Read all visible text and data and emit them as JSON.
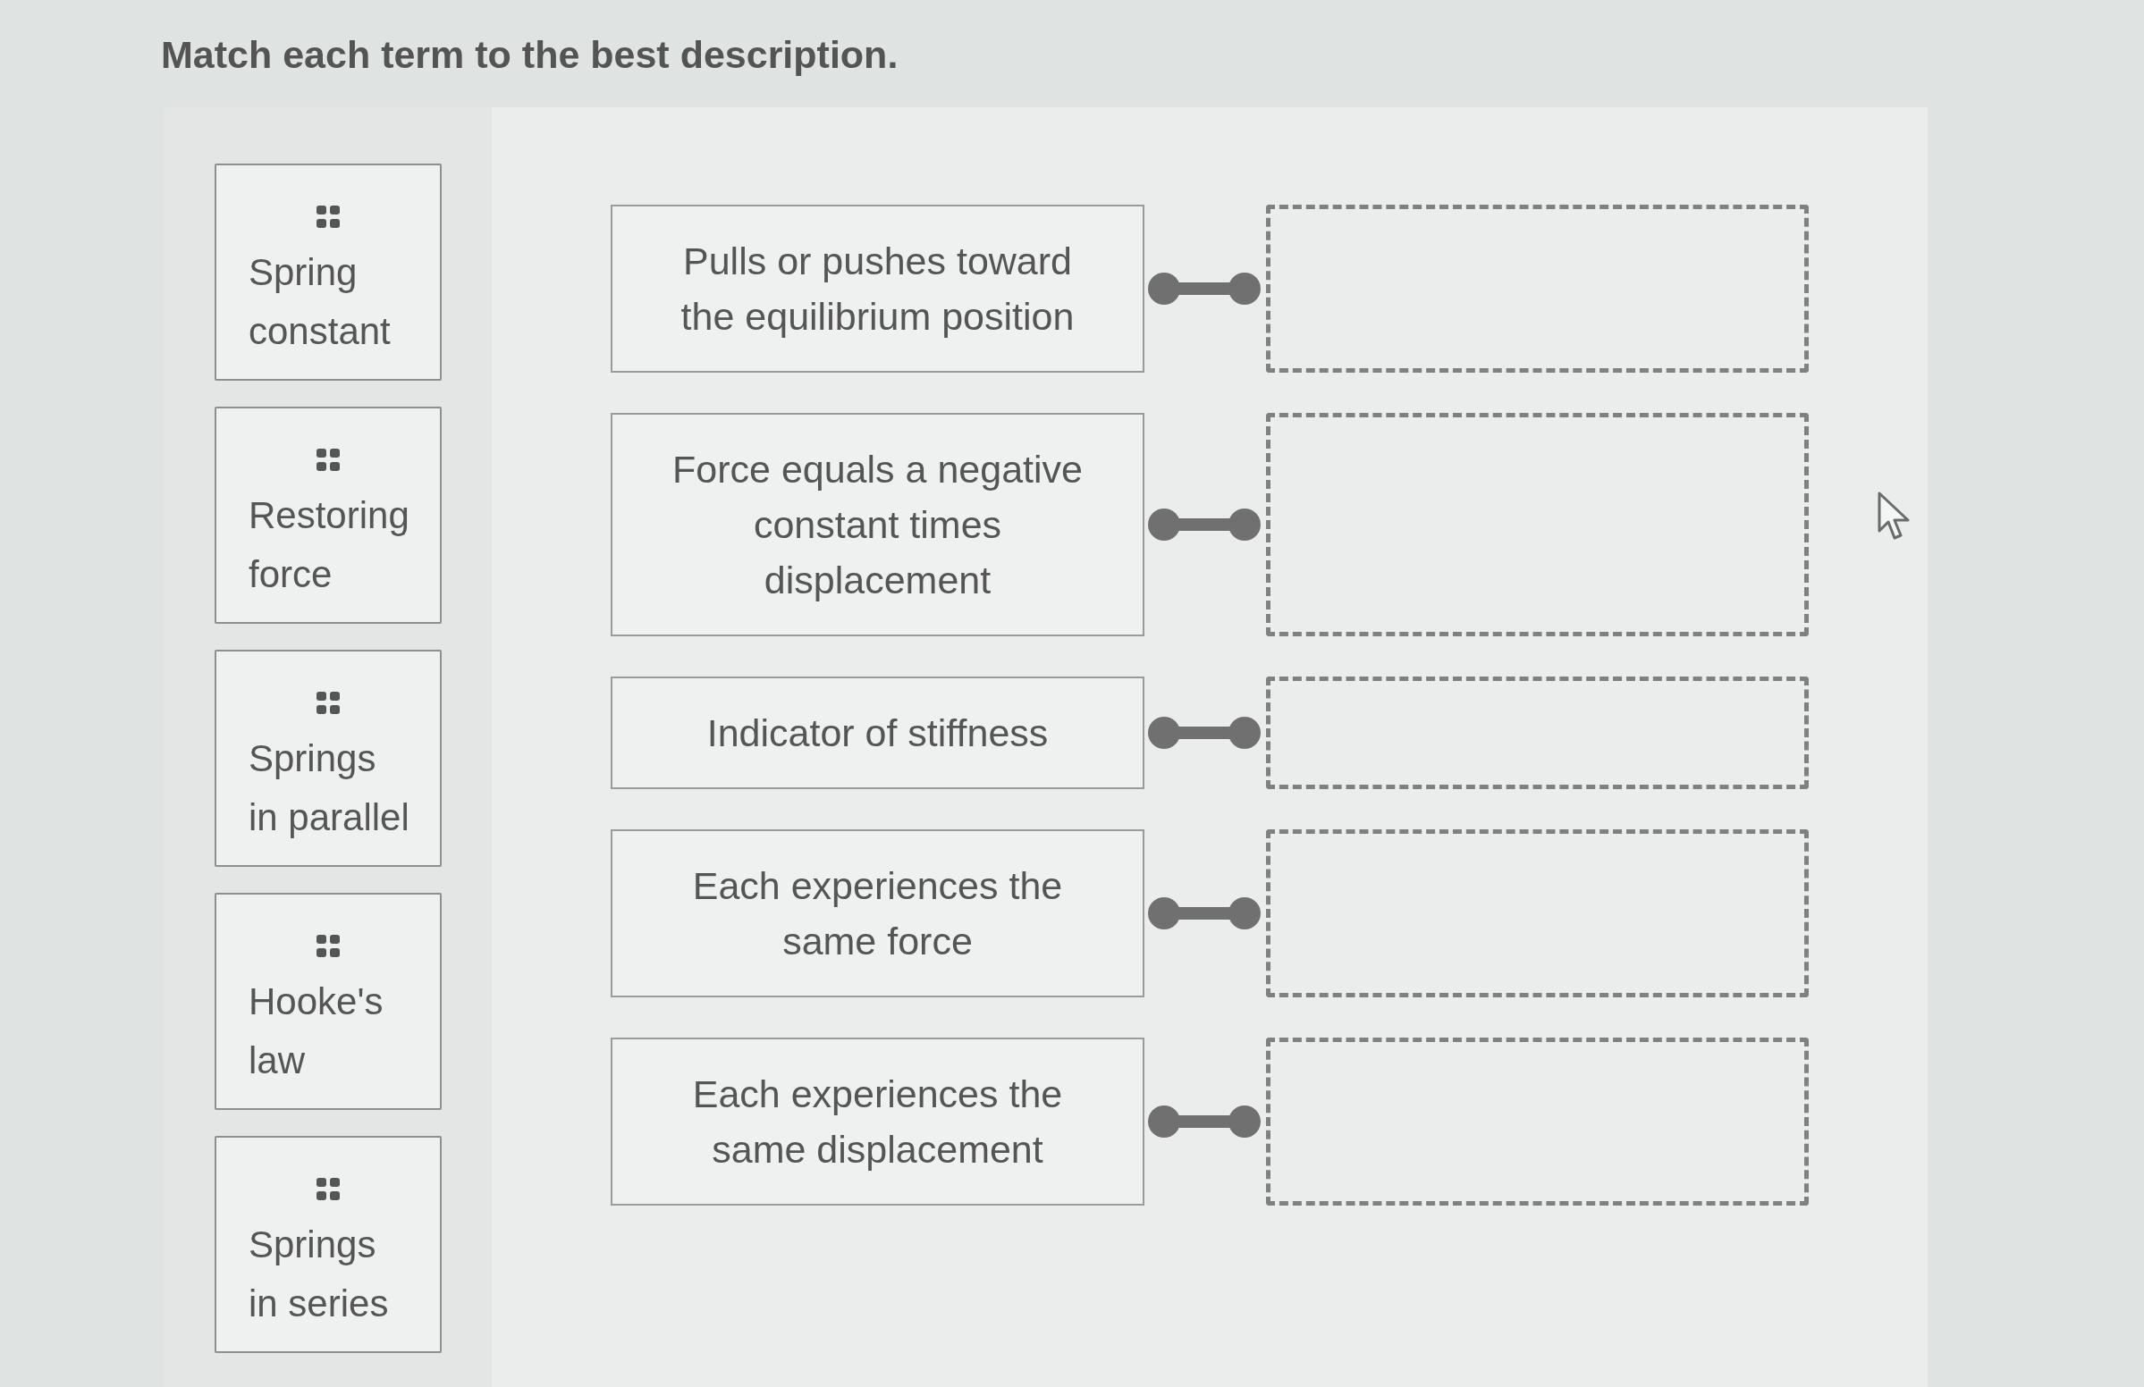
{
  "instruction": "Match each term to the best description.",
  "terms": [
    "Spring constant",
    "Restoring force",
    "Springs in parallel",
    "Hooke's law",
    "Springs in series"
  ],
  "descriptions": [
    "Pulls or pushes toward the equilibrium position",
    "Force equals a negative constant times displacement",
    "Indicator of stiffness",
    "Each experiences the same force",
    "Each experiences the same displacement"
  ]
}
